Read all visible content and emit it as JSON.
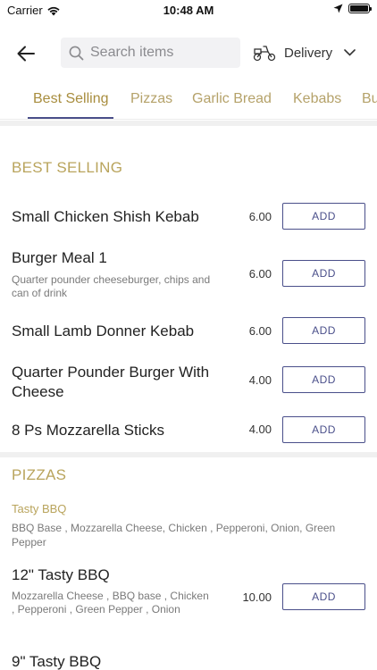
{
  "status_bar": {
    "carrier": "Carrier",
    "time": "10:48 AM"
  },
  "header": {
    "search_placeholder": "Search items",
    "delivery_label": "Delivery"
  },
  "tabs": [
    {
      "label": "Best Selling",
      "active": true
    },
    {
      "label": "Pizzas",
      "active": false
    },
    {
      "label": "Garlic Bread",
      "active": false
    },
    {
      "label": "Kebabs",
      "active": false
    },
    {
      "label": "Bu",
      "active": false
    }
  ],
  "best_selling": {
    "title": "BEST SELLING",
    "items": [
      {
        "name": "Small Chicken Shish Kebab",
        "description": "",
        "price": "6.00",
        "button": "ADD"
      },
      {
        "name": "Burger Meal 1",
        "description": "Quarter pounder cheeseburger, chips and can of drink",
        "price": "6.00",
        "button": "ADD"
      },
      {
        "name": "Small Lamb Donner Kebab",
        "description": "",
        "price": "6.00",
        "button": "ADD"
      },
      {
        "name": "Quarter Pounder Burger With Cheese",
        "description": "",
        "price": "4.00",
        "button": "ADD"
      },
      {
        "name": "8 Ps Mozzarella Sticks",
        "description": "",
        "price": "4.00",
        "button": "ADD"
      }
    ]
  },
  "pizzas": {
    "title": "PIZZAS",
    "group_name": "Tasty BBQ",
    "group_description": "BBQ Base , Mozzarella Cheese, Chicken , Pepperoni, Onion, Green Pepper",
    "items": [
      {
        "name": "12\" Tasty BBQ",
        "description": "Mozzarella Cheese , BBQ base , Chicken , Pepperoni , Green Pepper , Onion",
        "price": "10.00",
        "button": "ADD"
      },
      {
        "name": "9\" Tasty BBQ",
        "description": "",
        "price": "",
        "button": ""
      }
    ]
  },
  "colors": {
    "accent": "#4a4f8a",
    "gold": "#b9a45c"
  }
}
